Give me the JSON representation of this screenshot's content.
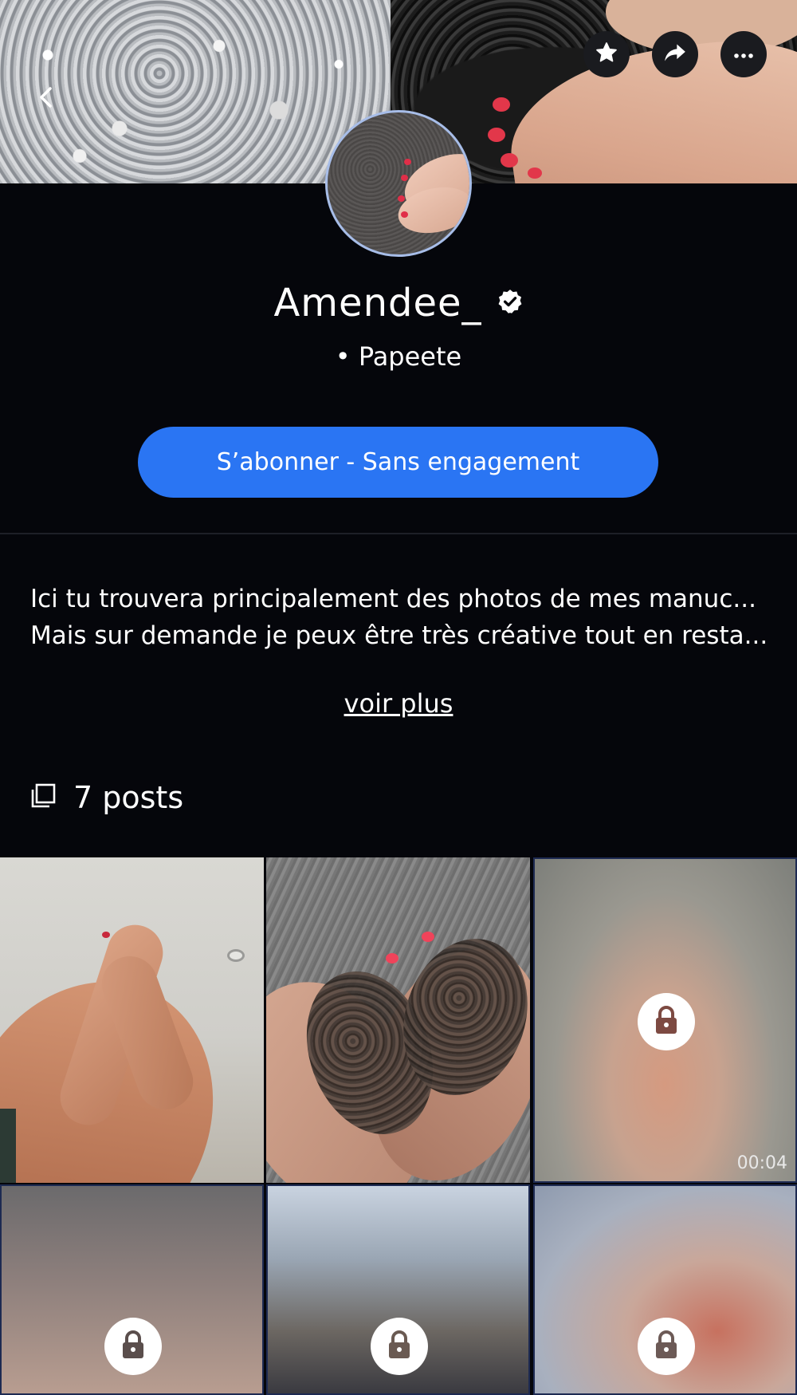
{
  "profile": {
    "name": "Amendee_",
    "location": "• Papeete",
    "verified_icon": "verified-badge-icon"
  },
  "header": {
    "back_icon": "chevron-left-icon",
    "favorite_icon": "star-icon",
    "share_icon": "share-arrow-icon",
    "more_icon": "more-dots-icon"
  },
  "actions": {
    "subscribe_label": "S’abonner - Sans engagement",
    "see_more_label": "voir plus"
  },
  "bio": {
    "lines": [
      "Ici tu trouvera principalement des photos de mes manuc...",
      "Mais sur demande je peux être très créative tout en resta..."
    ]
  },
  "posts": {
    "count_label": "7 posts",
    "icon": "posts-stack-icon",
    "tiles": [
      {
        "locked": false,
        "duration": ""
      },
      {
        "locked": false,
        "duration": ""
      },
      {
        "locked": true,
        "duration": "00:04"
      },
      {
        "locked": true,
        "duration": ""
      },
      {
        "locked": true,
        "duration": ""
      },
      {
        "locked": true,
        "duration": ""
      }
    ]
  },
  "colors": {
    "background": "#05060b",
    "accent": "#2a75f3",
    "avatar_ring": "#a7bde8"
  }
}
